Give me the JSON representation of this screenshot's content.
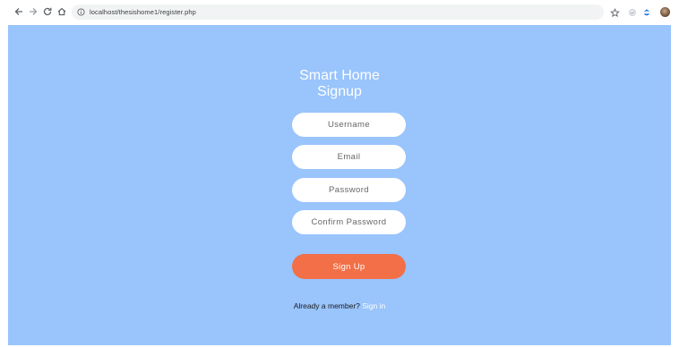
{
  "browser": {
    "url": "localhost/thesishome1/register.php",
    "icons": {
      "back": "arrow-left-icon",
      "forward": "arrow-right-icon",
      "reload": "reload-icon",
      "home": "home-icon",
      "site_info": "info-icon",
      "bookmark": "star-icon",
      "extension": "extension-icon",
      "tab_action": "puzzle-icon",
      "profile": "avatar"
    }
  },
  "page": {
    "background": "#99c4fc",
    "title_line1": "Smart Home",
    "title_line2": "Signup",
    "form": {
      "username_placeholder": "Username",
      "email_placeholder": "Email",
      "password_placeholder": "Password",
      "confirm_password_placeholder": "Confirm Password",
      "submit_label": "Sign Up",
      "submit_color": "#f26f47"
    },
    "footer": {
      "prompt": "Already a member?",
      "link_label": "Sign in"
    }
  }
}
